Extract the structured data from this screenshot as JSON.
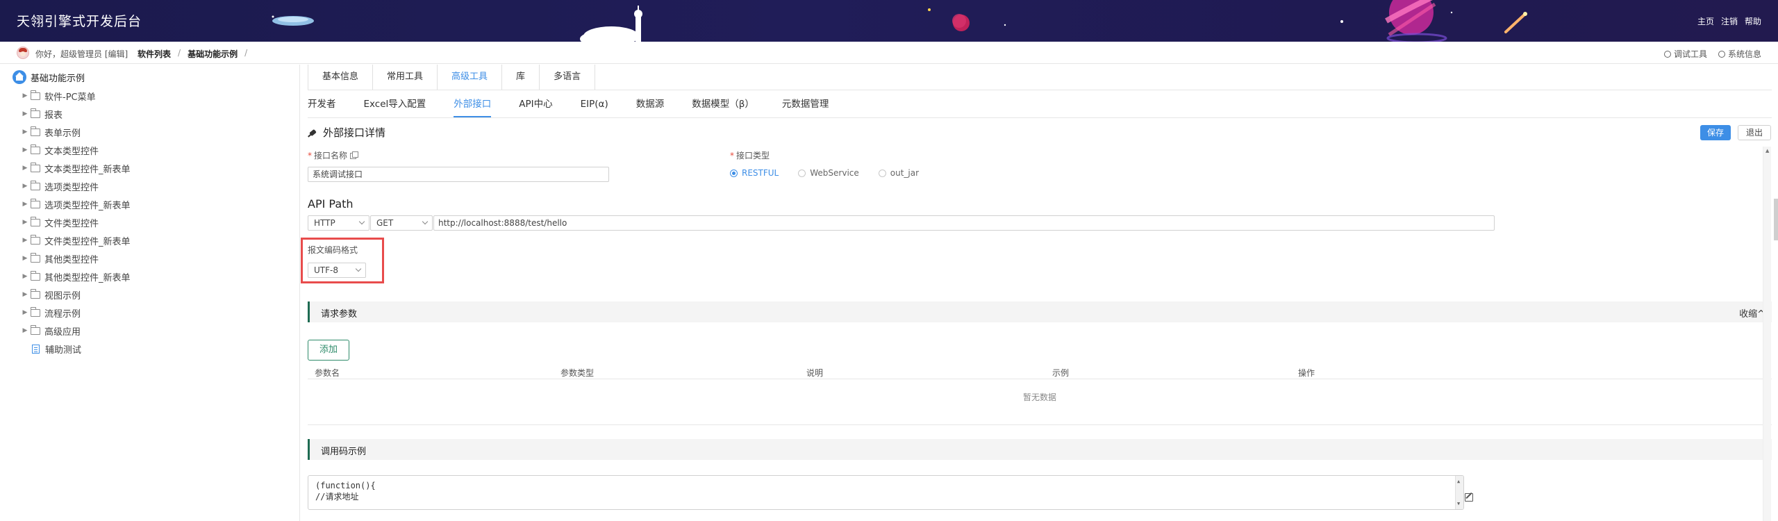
{
  "header": {
    "title": "天翎引擎式开发后台",
    "links": [
      "主页",
      "注销",
      "帮助"
    ]
  },
  "topbar": {
    "greeting": "你好，超级管理员 [编辑]",
    "breadcrumbs": [
      "软件列表",
      "基础功能示例"
    ],
    "separator": "/",
    "debug_tool": "调试工具",
    "system_info": "系统信息"
  },
  "sidebar": {
    "root_label": "基础功能示例",
    "items": [
      {
        "label": "软件-PC菜单",
        "type": "folder"
      },
      {
        "label": "报表",
        "type": "folder"
      },
      {
        "label": "表单示例",
        "type": "folder"
      },
      {
        "label": "文本类型控件",
        "type": "folder"
      },
      {
        "label": "文本类型控件_新表单",
        "type": "folder"
      },
      {
        "label": "选项类型控件",
        "type": "folder"
      },
      {
        "label": "选项类型控件_新表单",
        "type": "folder"
      },
      {
        "label": "文件类型控件",
        "type": "folder"
      },
      {
        "label": "文件类型控件_新表单",
        "type": "folder"
      },
      {
        "label": "其他类型控件",
        "type": "folder"
      },
      {
        "label": "其他类型控件_新表单",
        "type": "folder"
      },
      {
        "label": "视图示例",
        "type": "folder"
      },
      {
        "label": "流程示例",
        "type": "folder"
      },
      {
        "label": "高级应用",
        "type": "folder"
      },
      {
        "label": "辅助测试",
        "type": "doc"
      }
    ]
  },
  "main": {
    "tabs1": [
      {
        "label": "基本信息",
        "active": false
      },
      {
        "label": "常用工具",
        "active": false
      },
      {
        "label": "高级工具",
        "active": true
      },
      {
        "label": "库",
        "active": false
      },
      {
        "label": "多语言",
        "active": false
      }
    ],
    "tabs2": [
      {
        "label": "开发者",
        "active": false
      },
      {
        "label": "Excel导入配置",
        "active": false
      },
      {
        "label": "外部接口",
        "active": true
      },
      {
        "label": "API中心",
        "active": false
      },
      {
        "label": "EIP(α)",
        "active": false
      },
      {
        "label": "数据源",
        "active": false
      },
      {
        "label": "数据模型（β）",
        "active": false
      },
      {
        "label": "元数据管理",
        "active": false
      }
    ],
    "detail_title": "外部接口详情",
    "save_label": "保存",
    "exit_label": "退出",
    "api_name_label": "接口名称",
    "api_name_value": "系统调试接口",
    "api_type_label": "接口类型",
    "api_types": [
      {
        "label": "RESTFUL",
        "checked": true
      },
      {
        "label": "WebService",
        "checked": false
      },
      {
        "label": "out_jar",
        "checked": false
      }
    ],
    "api_path_title": "API Path",
    "protocol": "HTTP",
    "method": "GET",
    "url": "http://localhost:8888/test/hello",
    "encoding_label": "报文编码格式",
    "encoding_value": "UTF-8",
    "request_params_title": "请求参数",
    "collapse_label": "收缩^",
    "add_label": "添加",
    "table_columns": [
      "参数名",
      "参数类型",
      "说明",
      "示例",
      "操作"
    ],
    "empty_text": "暂无数据",
    "code_example_title": "调用码示例",
    "code_lines": [
      "(function(){",
      "//请求地址"
    ]
  }
}
